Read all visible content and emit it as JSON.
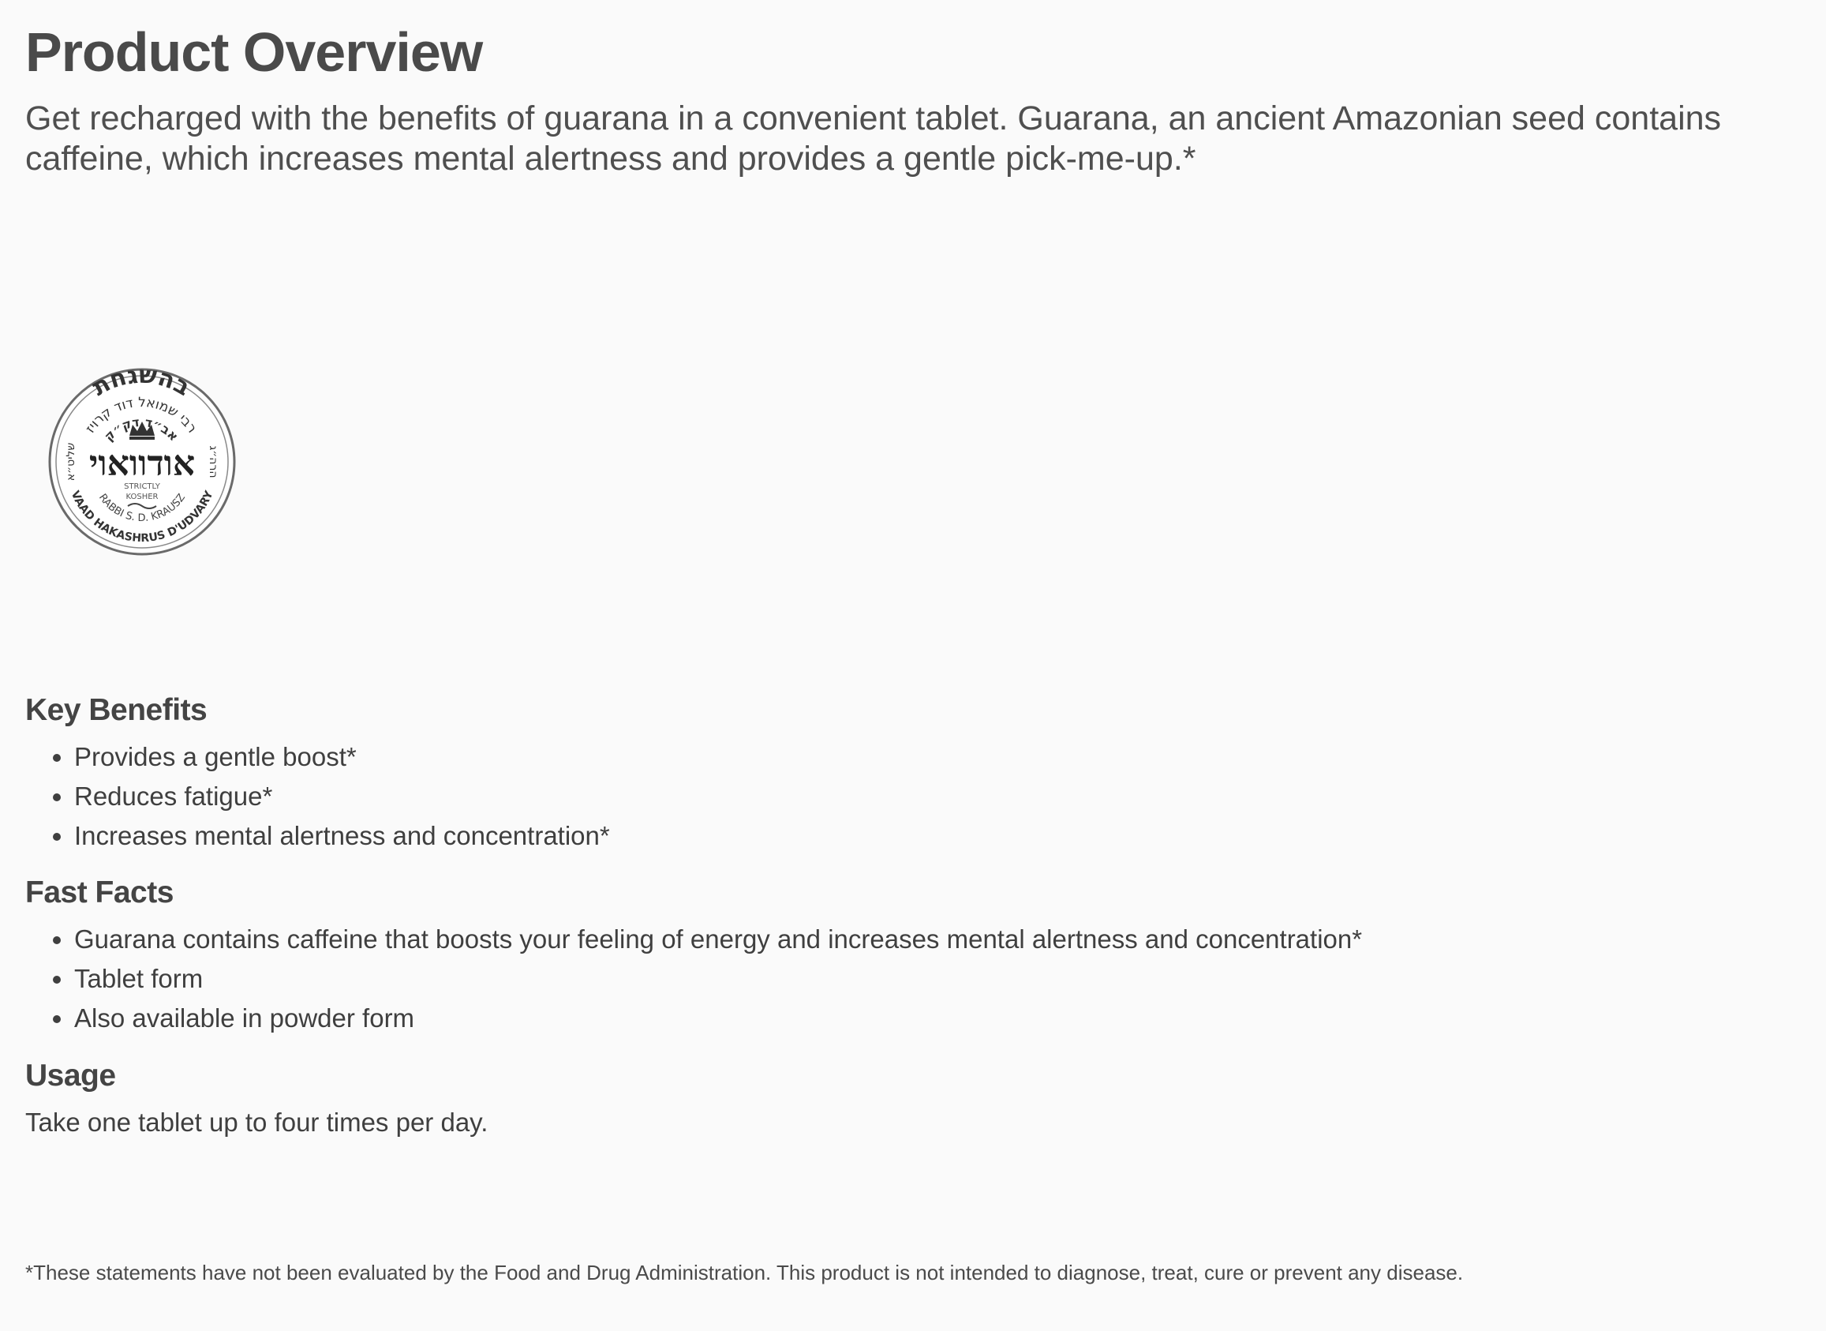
{
  "product_overview": {
    "title": "Product Overview",
    "intro": "Get recharged with the benefits of guarana in a convenient tablet. Guarana, an ancient Amazonian seed contains caffeine, which increases mental alertness and provides a gentle pick-me-up.*"
  },
  "kosher_seal": {
    "top_arc": "בהשגחת",
    "upper_arc": "רבי שמואל דוד קרויז",
    "inner_arc": "אב״ד דק״ק",
    "main_text": "אודוואוי",
    "subtitle_line1": "STRICTLY",
    "subtitle_line2": "KOSHER",
    "rabbi_line": "RABBI S. D. KRAUSZ",
    "bottom_arc": "VAAD HAKASHRUS D'UDVARY",
    "left_arc": "שליט״א",
    "right_arc": "הרה״ג",
    "icon": "crown-icon"
  },
  "key_benefits": {
    "heading": "Key Benefits",
    "items": [
      "Provides a gentle boost*",
      "Reduces fatigue*",
      "Increases mental alertness and concentration*"
    ]
  },
  "fast_facts": {
    "heading": "Fast Facts",
    "items": [
      "Guarana contains caffeine that boosts your feeling of energy and increases mental alertness and concentration*",
      "Tablet form",
      "Also available in powder form"
    ]
  },
  "usage": {
    "heading": "Usage",
    "text": "Take one tablet up to four times per day."
  },
  "disclaimer": "*These statements have not been evaluated by the Food and Drug Administration. This product is not intended to diagnose, treat, cure or prevent any disease."
}
